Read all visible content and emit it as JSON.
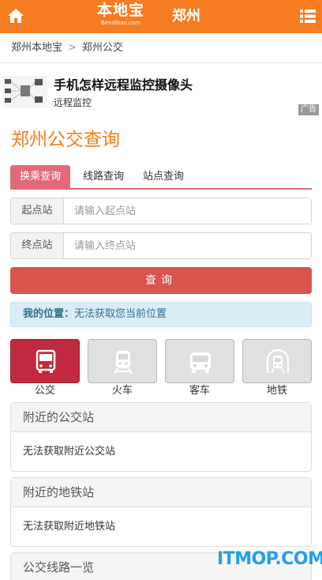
{
  "header": {
    "logo_main": "本地宝",
    "logo_sub": "Bendibao.com",
    "city": "郑州",
    "home_icon": "home-icon",
    "menu_icon": "list-menu-icon",
    "bar_color": "#f57c1f"
  },
  "breadcrumb": {
    "items": [
      "郑州本地宝",
      "郑州公交"
    ],
    "separator": ">"
  },
  "ad": {
    "title": "手机怎样远程监控摄像头",
    "subtitle": "远程监控",
    "tag": "广告"
  },
  "page": {
    "title": "郑州公交查询",
    "title_color": "#f57c1f"
  },
  "tabs": [
    {
      "label": "换乘查询",
      "active": true
    },
    {
      "label": "线路查询",
      "active": false
    },
    {
      "label": "站点查询",
      "active": false
    }
  ],
  "form": {
    "start_label": "起点站",
    "start_placeholder": "请输入起点站",
    "start_value": "",
    "end_label": "终点站",
    "end_placeholder": "请输入终点站",
    "end_value": "",
    "submit_label": "查询"
  },
  "location": {
    "label": "我的位置：",
    "value": "无法获取您当前位置"
  },
  "modes": [
    {
      "label": "公交",
      "icon": "bus-icon",
      "active": true
    },
    {
      "label": "火车",
      "icon": "train-icon",
      "active": false
    },
    {
      "label": "客车",
      "icon": "coach-icon",
      "active": false
    },
    {
      "label": "地铁",
      "icon": "subway-icon",
      "active": false
    }
  ],
  "panels": [
    {
      "title": "附近的公交站",
      "content": "无法获取附近公交站"
    },
    {
      "title": "附近的地铁站",
      "content": "无法获取附近地铁站"
    },
    {
      "title": "公交线路一览"
    }
  ],
  "watermark": "ITMOP.COM",
  "colors": {
    "accent_tab": "#e06a7a",
    "button": "#d9534f",
    "active_mode": "#c0293e",
    "info_bg": "#d9edf7",
    "info_text": "#31708f"
  }
}
